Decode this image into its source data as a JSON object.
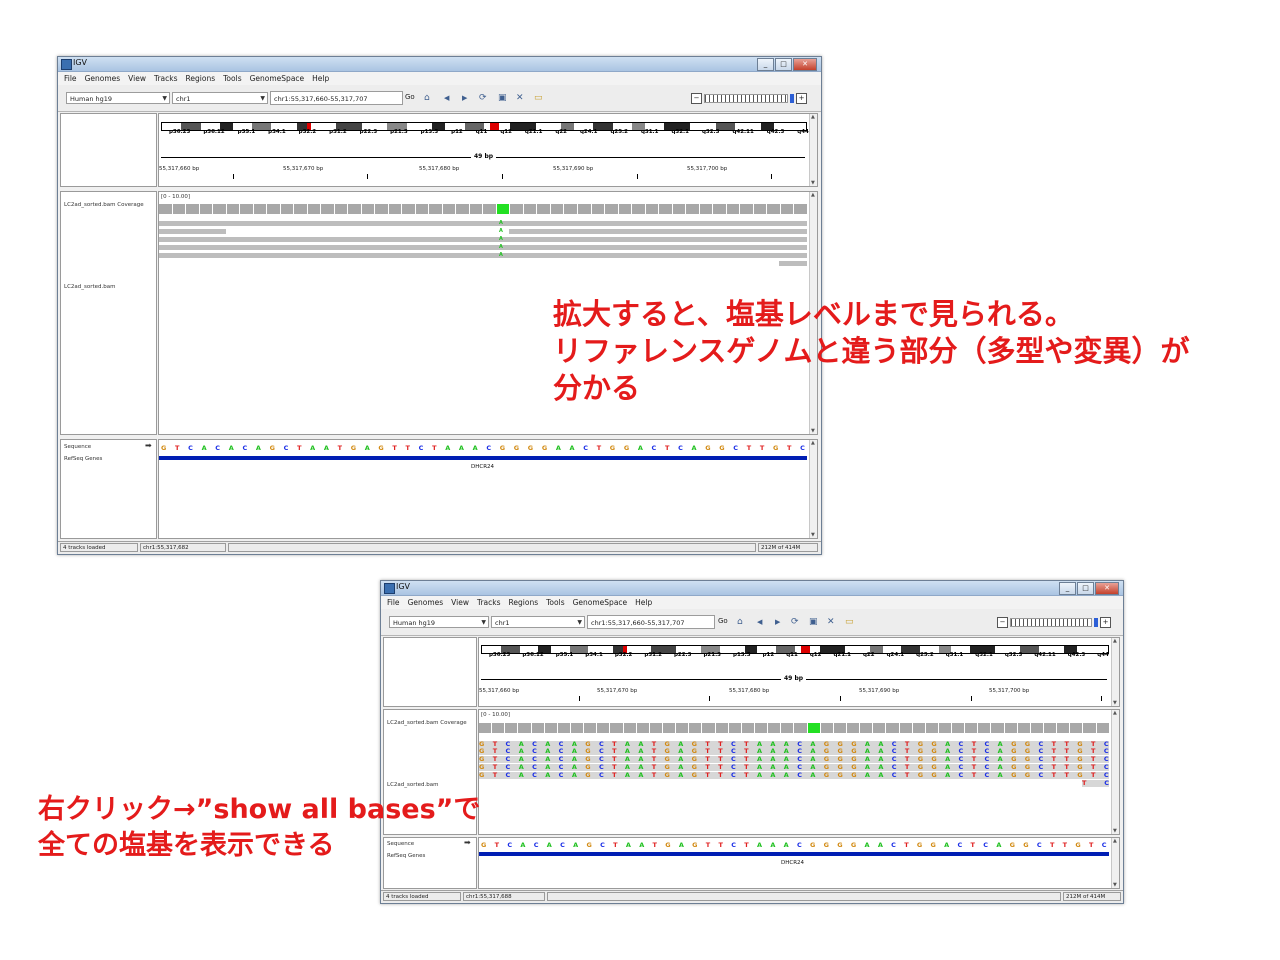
{
  "window_title": "IGV",
  "menu": [
    "File",
    "Genomes",
    "View",
    "Tracks",
    "Regions",
    "Tools",
    "GenomeSpace",
    "Help"
  ],
  "genome": "Human hg19",
  "chromosome": "chr1",
  "locus": "chr1:55,317,660-55,317,707",
  "go_label": "Go",
  "toolbar_icons": [
    "home-icon",
    "back-icon",
    "forward-icon",
    "refresh-icon",
    "region-icon",
    "close-icon",
    "popup-icon"
  ],
  "cytobands": [
    "p36.23",
    "p36.12",
    "p35.1",
    "p34.1",
    "p32.2",
    "p31.2",
    "p22.3",
    "p21.3",
    "p13.3",
    "p12",
    "q11",
    "q12",
    "q21.1",
    "q22",
    "q24.1",
    "q25.2",
    "q31.1",
    "q32.1",
    "q32.3",
    "q42.11",
    "q42.3",
    "q44"
  ],
  "span_label": "49 bp",
  "ruler_coords_1": [
    "55,317,660 bp",
    "55,317,670 bp",
    "55,317,680 bp",
    "55,317,690 bp",
    "55,317,700 bp"
  ],
  "ruler_coords_2": [
    "55,317,660 bp",
    "55,317,670 bp",
    "55,317,680 bp",
    "55,317,690 bp",
    "55,317,700 bp"
  ],
  "coverage_range": "[0 - 10.00]",
  "track_coverage": "LC2ad_sorted.bam Coverage",
  "track_reads": "LC2ad_sorted.bam",
  "track_sequence": "Sequence",
  "track_genes": "RefSeq Genes",
  "sequence": "GTCACACAGCTAATGAGTTCTAAACGGGGAACTGGACTCAGGCTTGTC",
  "read_bases": "GTCACACAGCTAATGAGTTCTAAACAGGGAACTGGACTCAGGCTTGTC",
  "gene_name": "DHCR24",
  "mismatch_base": "A",
  "status": {
    "tracks": "4 tracks loaded",
    "pos1": "chr1:55,317,682",
    "pos2": "chr1:55,317,688",
    "mem": "212M of 414M"
  },
  "base_colors": {
    "A": "#20c020",
    "C": "#1a2ee6",
    "G": "#d28a12",
    "T": "#e02020"
  },
  "callout_1": [
    "拡大すると、塩基レベルまで見られる。",
    "リファレンスゲノムと違う部分（多型や変異）が",
    "分かる"
  ],
  "callout_2": [
    "右クリック→”show all bases”で",
    "全ての塩基を表示できる"
  ]
}
